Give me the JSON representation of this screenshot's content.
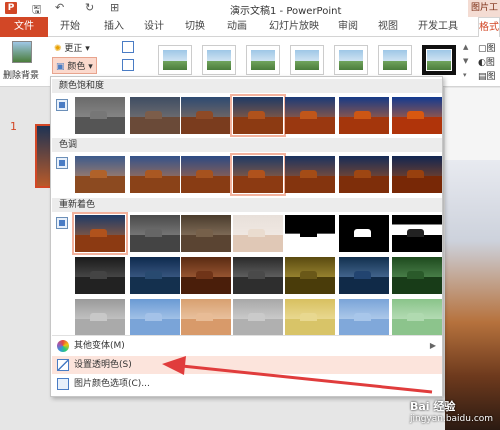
{
  "titlebar": {
    "app_icon": "P",
    "title": "演示文稿1 - PowerPoint",
    "context_tab": "图片工"
  },
  "tabs": [
    "文件",
    "开始",
    "插入",
    "设计",
    "切换",
    "动画",
    "幻灯片放映",
    "审阅",
    "视图",
    "开发工具",
    "格式"
  ],
  "ribbon": {
    "remove_bg": "删除背景",
    "corrections": "更正",
    "color": "颜色",
    "right_a": "图",
    "right_b": "图",
    "right_c": "图"
  },
  "slide_pane": {
    "slide_number": "1"
  },
  "dropdown": {
    "saturation_header": "颜色饱和度",
    "tone_header": "色调",
    "recolor_header": "重新着色",
    "more_variations": "其他变体(M)",
    "set_transparent": "设置透明色(S)",
    "picture_color_options": "图片颜色选项(C)..."
  },
  "watermark": {
    "brand": "Bai 经验",
    "url": "jingyan.baidu.com"
  },
  "colors": {
    "accent": "#d24726",
    "hover": "#fce4dc",
    "selected_border": "#f3b29d",
    "arrow": "#e03c3c"
  }
}
